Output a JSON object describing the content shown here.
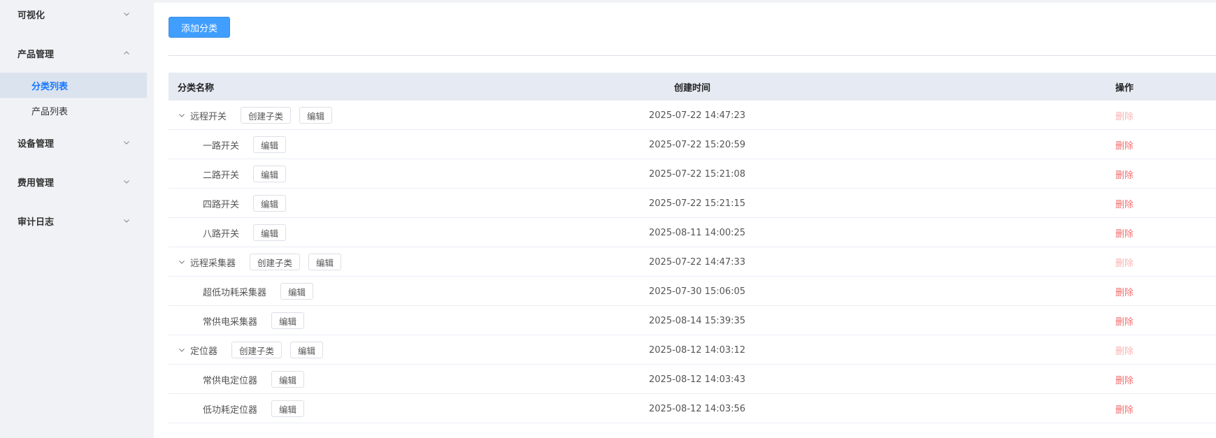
{
  "sidebar": {
    "groups": [
      {
        "label": "可视化",
        "expanded": false
      },
      {
        "label": "产品管理",
        "expanded": true
      },
      {
        "label": "设备管理",
        "expanded": false
      },
      {
        "label": "费用管理",
        "expanded": false
      },
      {
        "label": "审计日志",
        "expanded": false
      }
    ],
    "product_submenu": [
      {
        "label": "分类列表",
        "active": true
      },
      {
        "label": "产品列表",
        "active": false
      }
    ]
  },
  "toolbar": {
    "add_category_label": "添加分类"
  },
  "table": {
    "headers": {
      "name": "分类名称",
      "created": "创建时间",
      "ops": "操作"
    },
    "rows": [
      {
        "name": "远程开关",
        "level": 0,
        "time": "2025-07-22 14:47:23",
        "create_child": "创建子类",
        "edit": "编辑",
        "delete": "删除",
        "delete_disabled": true
      },
      {
        "name": "一路开关",
        "level": 1,
        "time": "2025-07-22 15:20:59",
        "edit": "编辑",
        "delete": "删除",
        "delete_disabled": false
      },
      {
        "name": "二路开关",
        "level": 1,
        "time": "2025-07-22 15:21:08",
        "edit": "编辑",
        "delete": "删除",
        "delete_disabled": false
      },
      {
        "name": "四路开关",
        "level": 1,
        "time": "2025-07-22 15:21:15",
        "edit": "编辑",
        "delete": "删除",
        "delete_disabled": false
      },
      {
        "name": "八路开关",
        "level": 1,
        "time": "2025-08-11 14:00:25",
        "edit": "编辑",
        "delete": "删除",
        "delete_disabled": false
      },
      {
        "name": "远程采集器",
        "level": 0,
        "time": "2025-07-22 14:47:33",
        "create_child": "创建子类",
        "edit": "编辑",
        "delete": "删除",
        "delete_disabled": true
      },
      {
        "name": "超低功耗采集器",
        "level": 1,
        "time": "2025-07-30 15:06:05",
        "edit": "编辑",
        "delete": "删除",
        "delete_disabled": false
      },
      {
        "name": "常供电采集器",
        "level": 1,
        "time": "2025-08-14 15:39:35",
        "edit": "编辑",
        "delete": "删除",
        "delete_disabled": false
      },
      {
        "name": "定位器",
        "level": 0,
        "time": "2025-08-12 14:03:12",
        "create_child": "创建子类",
        "edit": "编辑",
        "delete": "删除",
        "delete_disabled": true
      },
      {
        "name": "常供电定位器",
        "level": 1,
        "time": "2025-08-12 14:03:43",
        "edit": "编辑",
        "delete": "删除",
        "delete_disabled": false
      },
      {
        "name": "低功耗定位器",
        "level": 1,
        "time": "2025-08-12 14:03:56",
        "edit": "编辑",
        "delete": "删除",
        "delete_disabled": false
      }
    ]
  },
  "colors": {
    "primary": "#409eff",
    "danger": "#f56c6c",
    "danger_disabled": "#f8b4b4",
    "active_menu": "#1677ff"
  }
}
